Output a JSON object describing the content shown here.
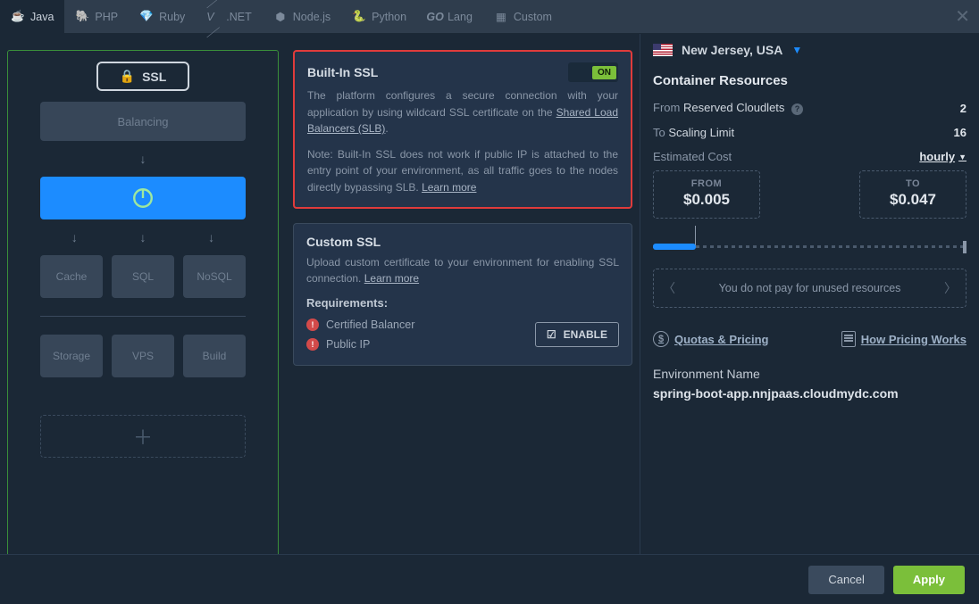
{
  "tabs": [
    {
      "label": "Java"
    },
    {
      "label": "PHP"
    },
    {
      "label": "Ruby"
    },
    {
      "label": ".NET"
    },
    {
      "label": "Node.js"
    },
    {
      "label": "Python"
    },
    {
      "label": "Lang"
    },
    {
      "label": "Custom"
    }
  ],
  "region": {
    "name": "New Jersey, USA"
  },
  "topology": {
    "ssl_badge": "SSL",
    "balancing": "Balancing",
    "cache": "Cache",
    "sql": "SQL",
    "nosql": "NoSQL",
    "storage": "Storage",
    "vps": "VPS",
    "build": "Build"
  },
  "builtin": {
    "title": "Built-In SSL",
    "toggle": "ON",
    "desc": "The platform configures a secure connection with your application by using wildcard SSL certificate on the ",
    "link1": "Shared Load Balancers (SLB)",
    "note": "Note: Built-In SSL does not work if public IP is attached to the entry point of your environment, as all traffic goes to the nodes directly bypassing SLB. ",
    "learn": "Learn more"
  },
  "custom": {
    "title": "Custom SSL",
    "desc": "Upload custom certificate to your environment for enabling SSL connection. ",
    "learn": "Learn more",
    "req": "Requirements:",
    "req1": "Certified Balancer",
    "req2": "Public IP",
    "enable": "ENABLE"
  },
  "resources": {
    "title": "Container Resources",
    "from_lbl": "From",
    "from_name": "Reserved Cloudlets",
    "from_val": "2",
    "to_lbl": "To",
    "to_name": "Scaling Limit",
    "to_val": "16",
    "cost_lbl": "Estimated Cost",
    "period": "hourly",
    "from_cost_lbl": "FROM",
    "from_cost": "$0.005",
    "to_cost_lbl": "TO",
    "to_cost": "$0.047",
    "pay_info": "You do not pay for unused resources",
    "quotas": "Quotas & Pricing",
    "how": "How Pricing Works",
    "env_lbl": "Environment Name",
    "env_name": "spring-boot-app.nnjpaas.cloudmydc.com"
  },
  "footer": {
    "cancel": "Cancel",
    "apply": "Apply"
  }
}
